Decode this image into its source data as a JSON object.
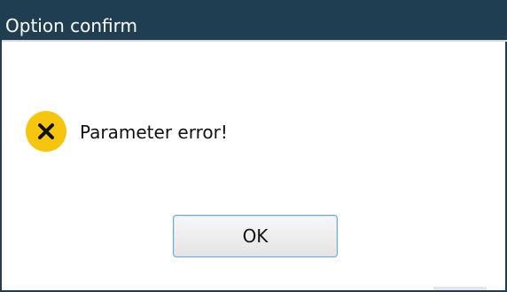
{
  "dialog": {
    "title": "Option confirm",
    "message": "Parameter error!",
    "ok_label": "OK"
  },
  "icons": {
    "message_icon": "error-x-icon"
  },
  "colors": {
    "titlebar": "#1f3e52",
    "icon_background": "#f6c60e",
    "button_border": "#6ba8dd"
  }
}
